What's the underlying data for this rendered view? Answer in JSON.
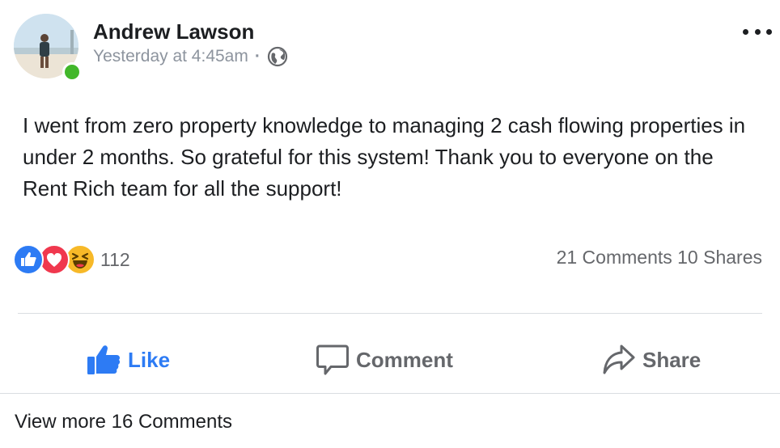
{
  "post": {
    "author": "Andrew Lawson",
    "timestamp": "Yesterday at 4:45am",
    "separator": "·",
    "privacy_icon": "globe-icon",
    "online_status_color": "#42b72a",
    "text": "I went from zero property knowledge to managing 2 cash flowing properties in under 2 months. So grateful for this system! Thank you to everyone on the Rent Rich team for all the support!"
  },
  "reactions": {
    "types": [
      "like",
      "love",
      "haha"
    ],
    "count": "112",
    "comments": "21 Comments",
    "shares": "10 Shares"
  },
  "actions": {
    "like_label": "Like",
    "comment_label": "Comment",
    "share_label": "Share"
  },
  "footer": {
    "view_more": "View more 16 Comments"
  },
  "colors": {
    "accent": "#2d7bf4",
    "text": "#1c1e21",
    "muted": "#65676b",
    "love": "#f0384e",
    "haha": "#f7b928"
  }
}
